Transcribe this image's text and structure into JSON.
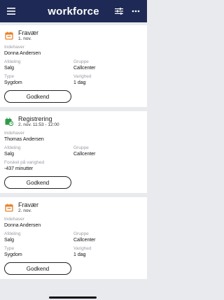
{
  "header": {
    "brand": "workforce",
    "icons": {
      "menu": "hamburger-menu-icon",
      "filter": "filter-sliders-icon",
      "more": "more-dots-icon"
    }
  },
  "cards": [
    {
      "type": "absence",
      "icon": "calendar-icon",
      "title": "Fravær",
      "subtitle": "1. nov.",
      "owner_label": "Indehaver",
      "owner": "Donna Andersen",
      "dept_label": "Afdeling",
      "dept": "Salg",
      "group_label": "Gruppe",
      "group": "Callcenter",
      "type_label": "Type",
      "type_value": "Sygdom",
      "duration_label": "Varighed",
      "duration": "1 dag",
      "button": "Godkend"
    },
    {
      "type": "registration",
      "icon": "clock-calendar-icon",
      "title": "Registrering",
      "subtitle": "2. nov. 11:53 - 12:00",
      "owner_label": "Indehaver",
      "owner": "Thomas Andersen",
      "dept_label": "Afdeling",
      "dept": "Salg",
      "group_label": "Gruppe",
      "group": "Callcenter",
      "diff_label": "Forskel på varighed",
      "diff": "-437 minutter",
      "button": "Godkend"
    },
    {
      "type": "absence",
      "icon": "calendar-icon",
      "title": "Fravær",
      "subtitle": "2. nov.",
      "owner_label": "Indehaver",
      "owner": "Donna Andersen",
      "dept_label": "Afdeling",
      "dept": "Salg",
      "group_label": "Gruppe",
      "group": "Callcenter",
      "type_label": "Type",
      "type_value": "Sygdom",
      "duration_label": "Varighed",
      "duration": "1 dag",
      "button": "Godkend"
    }
  ],
  "colors": {
    "header_bg": "#1e2a55",
    "absence_icon": "#e8812a",
    "registration_icon": "#2f9b4a",
    "background": "#e9eaee"
  }
}
